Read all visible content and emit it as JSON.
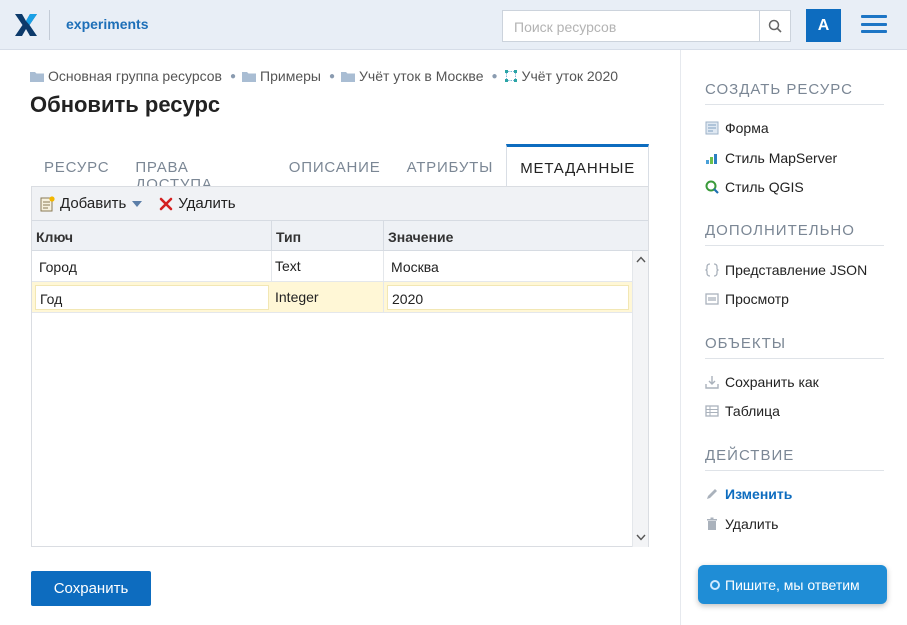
{
  "header": {
    "brand": "experiments",
    "search_placeholder": "Поиск ресурсов",
    "avatar_letter": "A"
  },
  "breadcrumb": [
    {
      "label": "Основная группа ресурсов",
      "icon": "folder-icon"
    },
    {
      "label": "Примеры",
      "icon": "folder-icon"
    },
    {
      "label": "Учёт уток в Москве",
      "icon": "folder-icon"
    },
    {
      "label": "Учёт уток 2020",
      "icon": "vector-layer-icon"
    }
  ],
  "page_title": "Обновить ресурс",
  "tabs": [
    {
      "label": "Ресурс",
      "active": false
    },
    {
      "label": "Права доступа",
      "active": false
    },
    {
      "label": "Описание",
      "active": false
    },
    {
      "label": "Атрибуты",
      "active": false
    },
    {
      "label": "Метаданные",
      "active": true
    }
  ],
  "toolbar": {
    "add_label": "Добавить",
    "delete_label": "Удалить"
  },
  "grid": {
    "columns": [
      "Ключ",
      "Тип",
      "Значение"
    ],
    "rows": [
      {
        "key": "Город",
        "type": "Text",
        "value": "Москва",
        "selected": false
      },
      {
        "key": "Год",
        "type": "Integer",
        "value": "2020",
        "selected": true
      }
    ]
  },
  "save_label": "Сохранить",
  "sidebar": {
    "sections": [
      {
        "title": "Создать ресурс",
        "items": [
          {
            "label": "Форма",
            "icon": "form-icon"
          },
          {
            "label": "Стиль MapServer",
            "icon": "mapserver-style-icon"
          },
          {
            "label": "Стиль QGIS",
            "icon": "qgis-style-icon"
          }
        ]
      },
      {
        "title": "Дополнительно",
        "items": [
          {
            "label": "Представление JSON",
            "icon": "json-icon"
          },
          {
            "label": "Просмотр",
            "icon": "preview-icon"
          }
        ]
      },
      {
        "title": "Объекты",
        "items": [
          {
            "label": "Сохранить как",
            "icon": "download-icon"
          },
          {
            "label": "Таблица",
            "icon": "table-icon"
          }
        ]
      },
      {
        "title": "Действие",
        "items": [
          {
            "label": "Изменить",
            "icon": "pencil-icon",
            "active": true
          },
          {
            "label": "Удалить",
            "icon": "trash-icon"
          }
        ]
      }
    ]
  },
  "chat_label": "Пишите, мы ответим",
  "colors": {
    "accent": "#0d6cbf",
    "header_bg": "#e8eef6",
    "selected_row": "#fff7d6"
  }
}
